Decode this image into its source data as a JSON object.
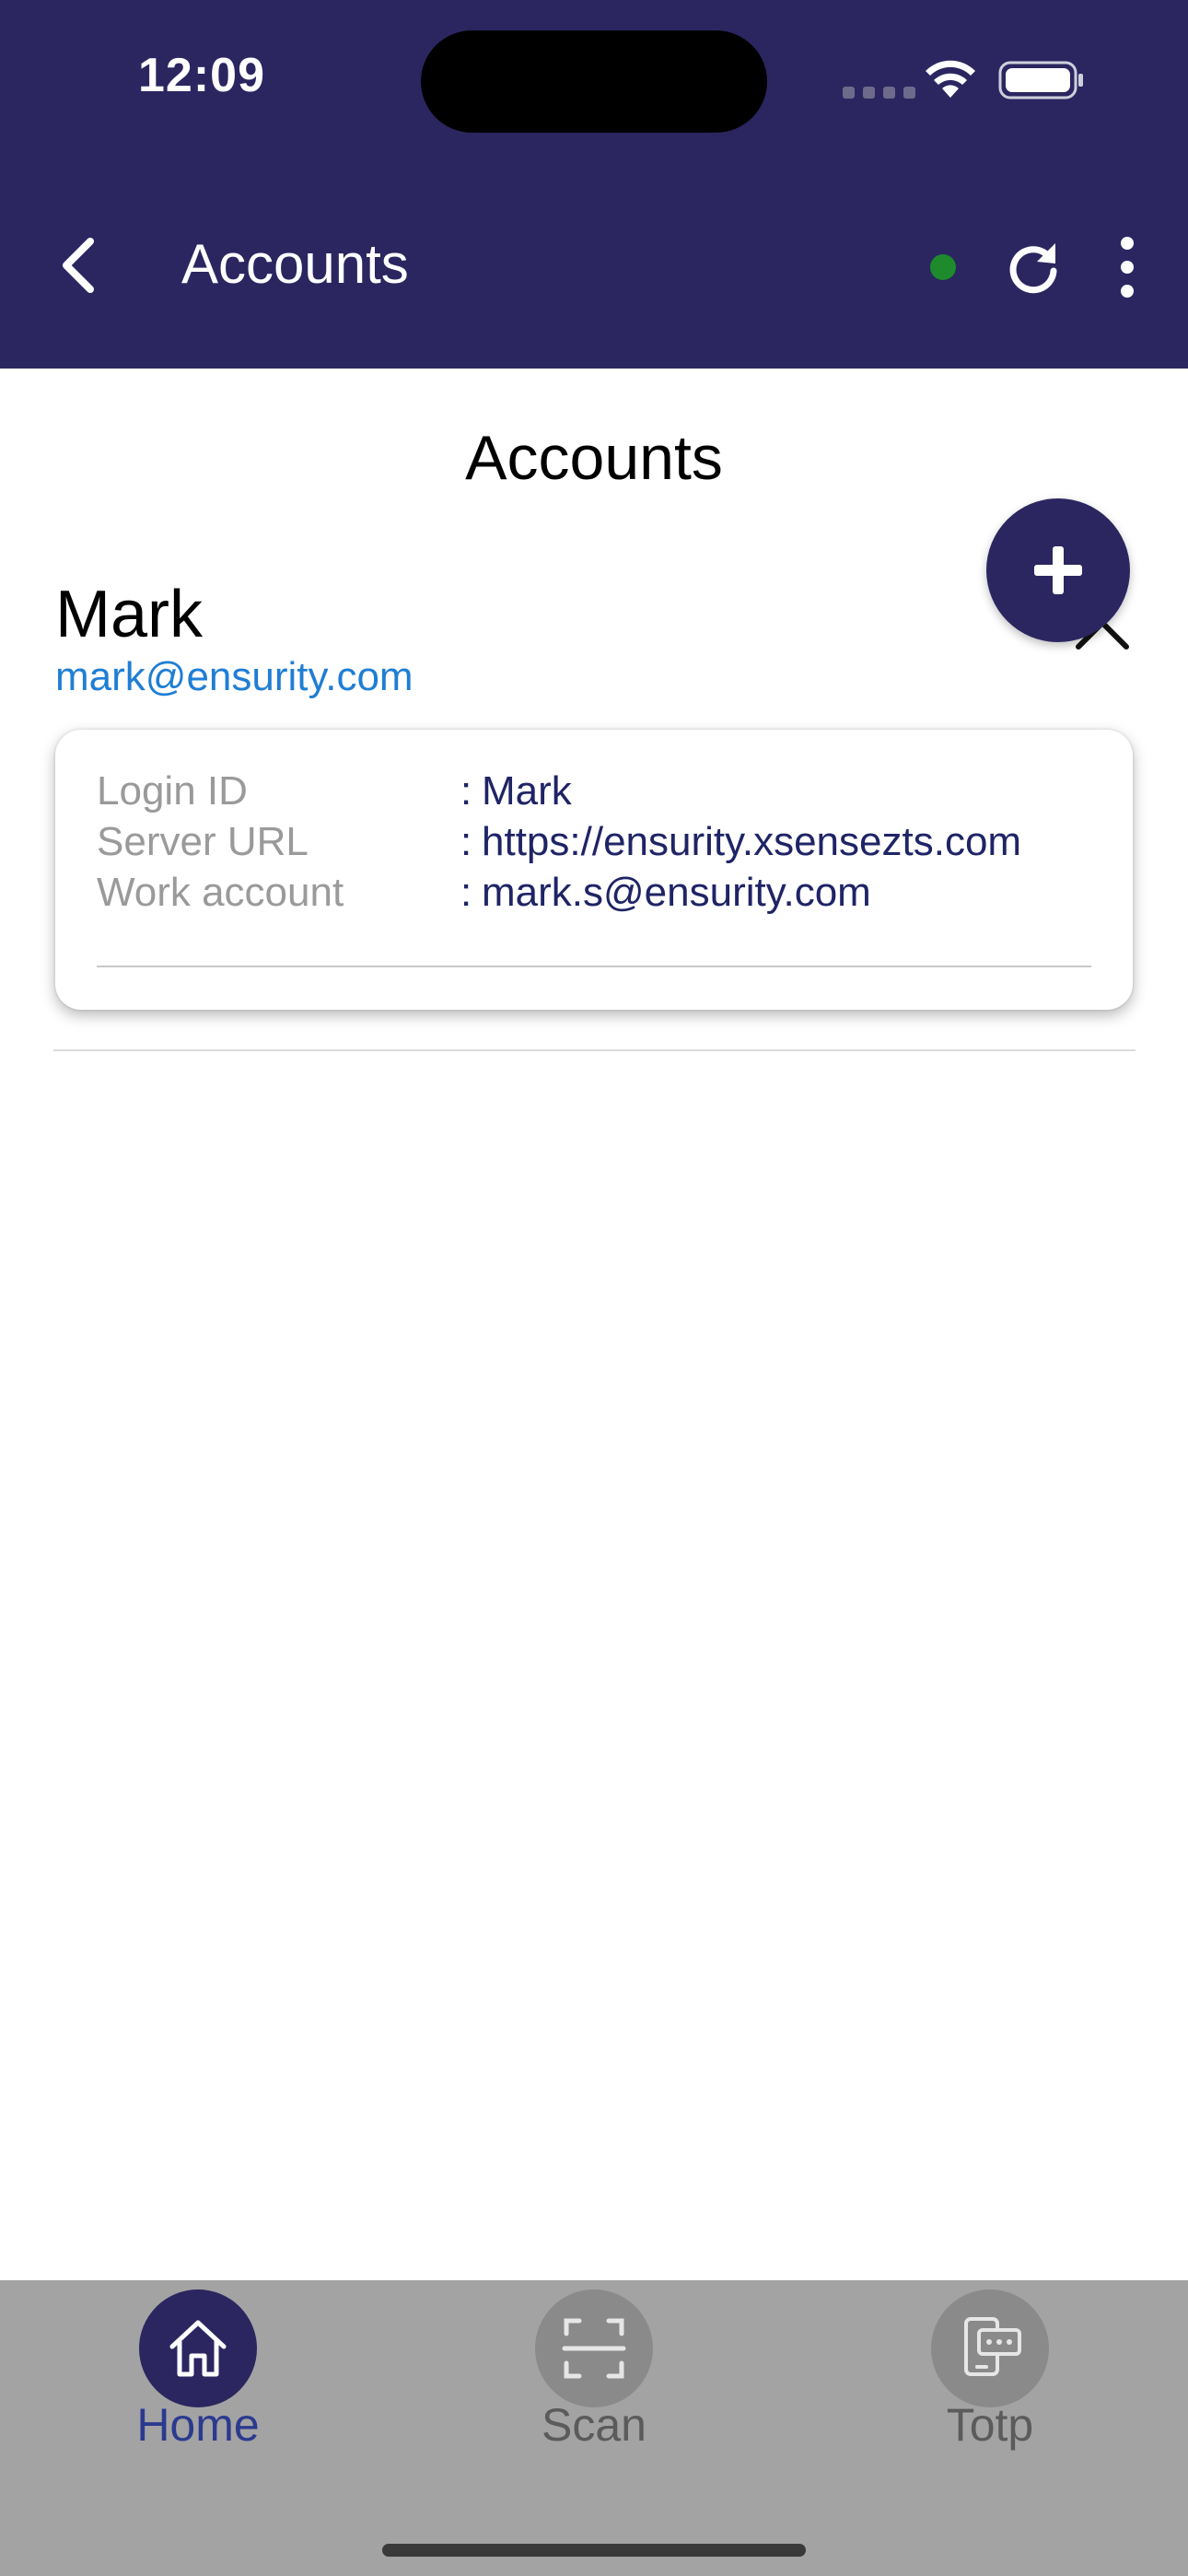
{
  "status_bar": {
    "time": "12:09"
  },
  "nav": {
    "title": "Accounts",
    "status_color": "#1d8b2c"
  },
  "main": {
    "heading": "Accounts",
    "account": {
      "name": "Mark",
      "email": "mark@ensurity.com",
      "details": [
        {
          "label": "Login ID",
          "separator": ":",
          "value": "Mark"
        },
        {
          "label": "Server URL",
          "separator": ":",
          "value": "https://ensurity.xsensezts.com"
        },
        {
          "label": "Work account",
          "separator": ":",
          "value": "mark.s@ensurity.com"
        }
      ]
    }
  },
  "tabbar": {
    "tabs": [
      {
        "label": "Home",
        "icon": "home-icon",
        "active": true
      },
      {
        "label": "Scan",
        "icon": "scan-icon",
        "active": false
      },
      {
        "label": "Totp",
        "icon": "totp-icon",
        "active": false
      }
    ]
  },
  "colors": {
    "brand": "#2b2660",
    "link": "#1f7ed4",
    "value_text": "#1f2466",
    "tabbar_bg": "#a3a3a3"
  }
}
